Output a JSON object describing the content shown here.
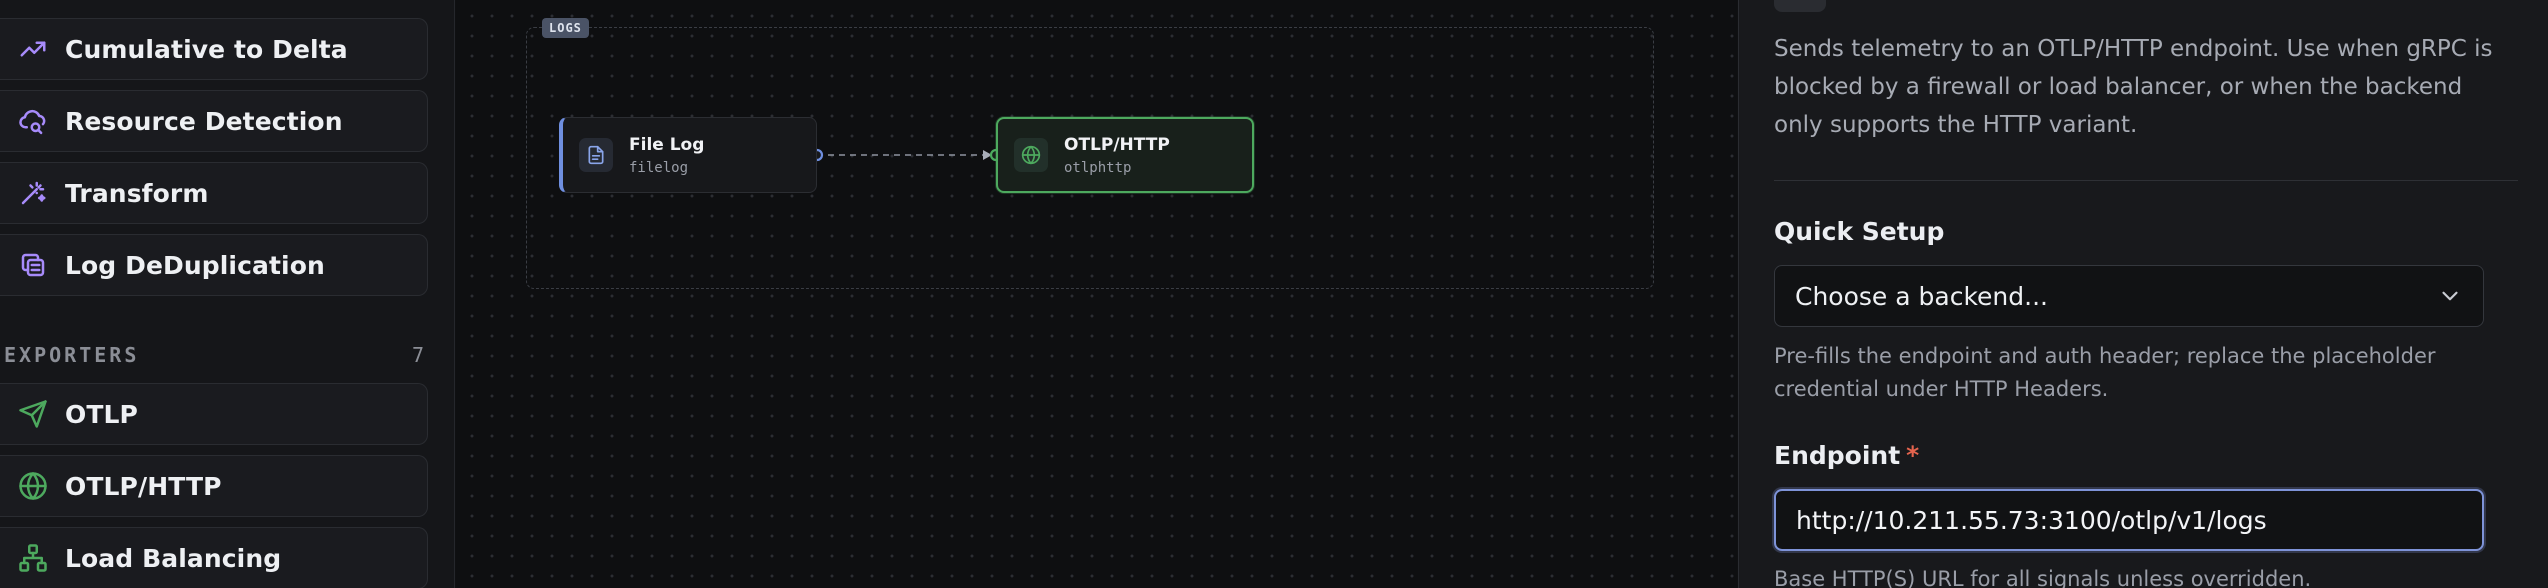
{
  "sidebar": {
    "items_top": [
      {
        "label": "Cumulative to Delta",
        "icon": "trending-up-icon"
      },
      {
        "label": "Resource Detection",
        "icon": "cloud-search-icon"
      },
      {
        "label": "Transform",
        "icon": "magic-wand-icon"
      },
      {
        "label": "Log DeDuplication",
        "icon": "copy-stack-icon"
      }
    ],
    "exporters_section": {
      "title": "EXPORTERS",
      "count": "7"
    },
    "exporters": [
      {
        "label": "OTLP",
        "icon": "send-icon"
      },
      {
        "label": "OTLP/HTTP",
        "icon": "globe-icon"
      },
      {
        "label": "Load Balancing",
        "icon": "network-icon"
      }
    ],
    "accent_color": "#a78bfa",
    "exporter_color": "#4da95e"
  },
  "canvas": {
    "group_label": "LOGS",
    "source_node": {
      "name": "File Log",
      "type": "filelog",
      "icon": "file-icon"
    },
    "dest_node": {
      "name": "OTLP/HTTP",
      "type": "otlphttp",
      "icon": "globe-icon"
    }
  },
  "panel": {
    "description": "Sends telemetry to an OTLP/HTTP endpoint. Use when gRPC is blocked by a firewall or load balancer, or when the backend only supports the HTTP variant.",
    "quick_setup": {
      "label": "Quick Setup",
      "selected": "Choose a backend...",
      "help": "Pre-fills the endpoint and auth header; replace the placeholder credential under HTTP Headers."
    },
    "endpoint": {
      "label": "Endpoint",
      "required_mark": "*",
      "value": "http://10.211.55.73:3100/otlp/v1/logs",
      "help": "Base HTTP(S) URL for all signals unless overridden."
    }
  }
}
